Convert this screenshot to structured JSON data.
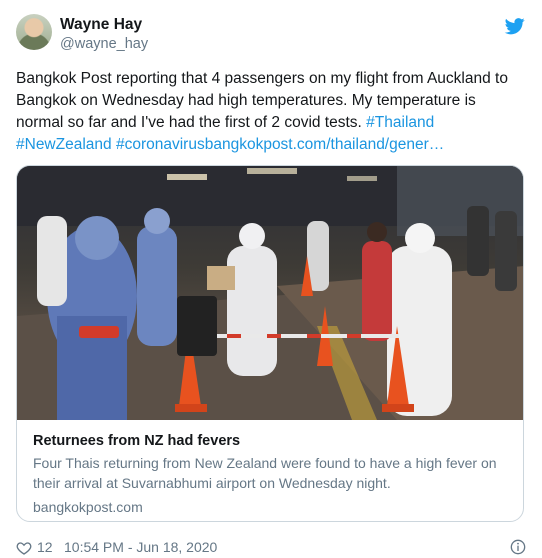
{
  "author": {
    "display_name": "Wayne Hay",
    "handle": "@wayne_hay",
    "avatar_icon": "user-avatar-photo"
  },
  "tweet": {
    "text_lines": [
      "Bangkok Post reporting that 4 passengers on my flight from Auckland to",
      "Bangkok on Wednesday had high temperatures. My temperature is",
      "normal so far and I've had the first of 2 covid tests. "
    ],
    "hashtag_thailand": "#Thailand",
    "hashtag_newzealand": "#NewZealand",
    "hashtag_coronavirus": "#coronavirus",
    "url": "bangkokpost.com/thailand/gener…"
  },
  "link_card": {
    "title": "Returnees from NZ had fevers",
    "description_lines": [
      "Four Thais returning from New Zealand were found to have a high fever on",
      "their arrival at Suvarnabhumi airport on Wednesday night."
    ],
    "domain": "bangkokpost.com"
  },
  "footer": {
    "like_count": "12",
    "timestamp": "10:54 PM - Jun 18, 2020"
  },
  "colors": {
    "link": "#1b95e0",
    "text": "#14171a",
    "secondary": "#657786",
    "twitter_blue": "#1da1f2"
  },
  "icons": [
    "twitter-bird-icon",
    "heart-icon",
    "info-icon"
  ]
}
